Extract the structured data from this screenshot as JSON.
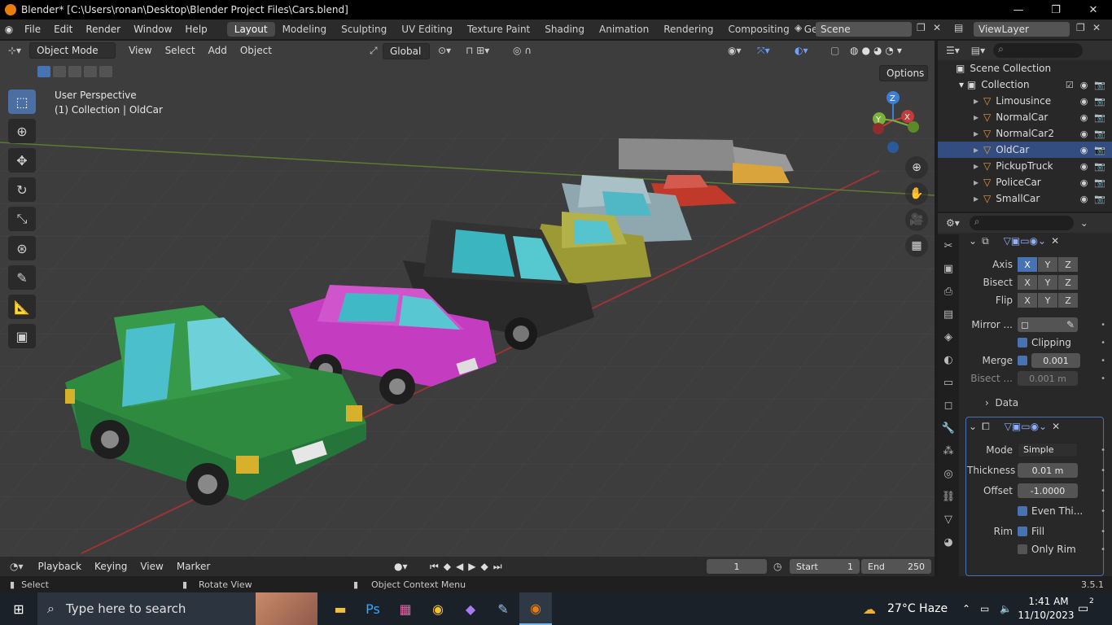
{
  "window": {
    "title": "Blender* [C:\\Users\\ronan\\Desktop\\Blender Project Files\\Cars.blend]",
    "minimize": "—",
    "maximize": "❐",
    "close": "✕"
  },
  "menubar": {
    "items": [
      "File",
      "Edit",
      "Render",
      "Window",
      "Help"
    ],
    "workspaces": [
      "Layout",
      "Modeling",
      "Sculpting",
      "UV Editing",
      "Texture Paint",
      "Shading",
      "Animation",
      "Rendering",
      "Compositing",
      "Geometry Noc"
    ],
    "active_workspace": "Layout",
    "scene": "Scene",
    "view_layer": "ViewLayer"
  },
  "viewport_header": {
    "mode": "Object Mode",
    "menus": [
      "View",
      "Select",
      "Add",
      "Object"
    ],
    "transform_orientation": "Global",
    "options": "Options"
  },
  "viewport": {
    "perspective": "User Perspective",
    "context": "(1) Collection | OldCar",
    "gizmo_axes": [
      "Z",
      "Y",
      "X"
    ],
    "colors": {
      "bg": "#3d3d3d",
      "x_axis": "#c43b3b",
      "y_axis": "#7bb03a",
      "z_axis": "#3d7fd6"
    }
  },
  "outliner": {
    "root": "Scene Collection",
    "collection": "Collection",
    "items": [
      "Limousince",
      "NormalCar",
      "NormalCar2",
      "OldCar",
      "PickupTruck",
      "PoliceCar",
      "SmallCar"
    ],
    "selected": "OldCar"
  },
  "properties": {
    "mirror": {
      "axis_label": "Axis",
      "bisect_label": "Bisect",
      "flip_label": "Flip",
      "axes": [
        "X",
        "Y",
        "Z"
      ],
      "mirror_object_label": "Mirror ...",
      "clipping_label": "Clipping",
      "merge_label": "Merge",
      "merge_value": "0.001",
      "bisect_dist_label": "Bisect ...",
      "bisect_dist_value": "0.001 m",
      "data_label": "Data"
    },
    "solidify": {
      "mode_label": "Mode",
      "mode_value": "Simple",
      "thickness_label": "Thickness",
      "thickness_value": "0.01 m",
      "offset_label": "Offset",
      "offset_value": "-1.0000",
      "even_label": "Even Thi...",
      "rim_label": "Rim",
      "fill_label": "Fill",
      "only_rim_label": "Only Rim"
    }
  },
  "timeline": {
    "menus": [
      "Playback",
      "Keying",
      "View",
      "Marker"
    ],
    "current_frame": "1",
    "start_label": "Start",
    "start": "1",
    "end_label": "End",
    "end": "250"
  },
  "statusbar": {
    "select": "Select",
    "rotate": "Rotate View",
    "context_menu": "Object Context Menu",
    "version": "3.5.1"
  },
  "taskbar": {
    "search_placeholder": "Type here to search",
    "weather": "27°C  Haze",
    "time": "1:41 AM",
    "date": "11/10/2023",
    "notifications": "2"
  }
}
